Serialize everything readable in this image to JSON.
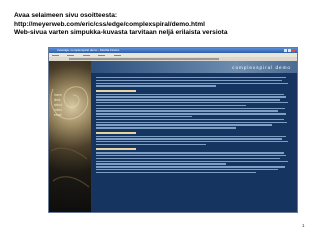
{
  "slide": {
    "title_lines": [
      "Avaa selaimeen sivu osoitteesta:",
      "http://meyerweb.com/eric/css/edge/complexspiral/demo.html",
      "Web-sivua varten simpukka-kuvasta tarvitaan neljä erilaista versiota"
    ],
    "page_number": "1"
  },
  "screenshot": {
    "window_title": "css/edge: complexspiral demo - Mozilla Firefox",
    "site_name": "complexspiral demo",
    "nav_items": [
      "home",
      "links",
      "about",
      "notes",
      "email"
    ],
    "colors": {
      "background": "#18345f",
      "accent": "#e8d4a0",
      "text": "#a9c2de"
    }
  }
}
